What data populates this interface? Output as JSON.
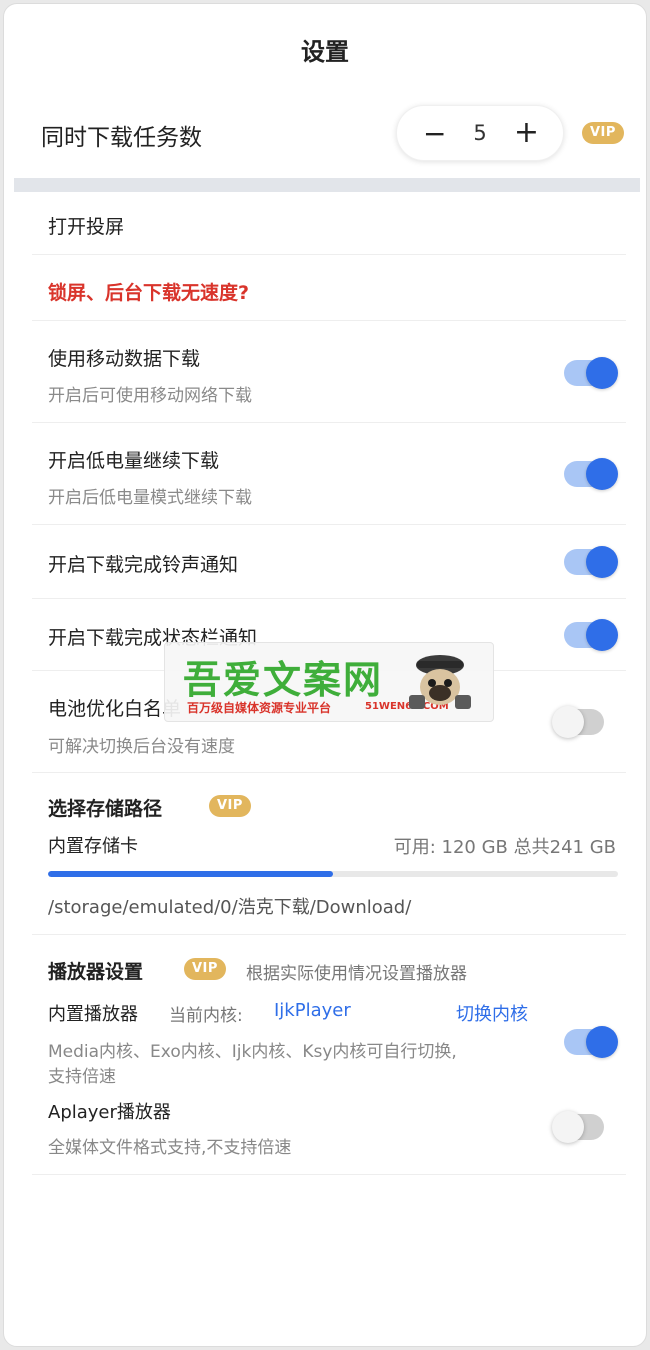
{
  "header": {
    "title": "设置"
  },
  "concurrent": {
    "label": "同时下载任务数",
    "minus": "−",
    "value": "5",
    "plus": "+",
    "vip": "VIP"
  },
  "items": {
    "cast": {
      "label": "打开投屏"
    },
    "lockscreen": {
      "label": "锁屏、后台下载无速度?"
    },
    "mobile_data": {
      "label": "使用移动数据下载",
      "sub": "开启后可使用移动网络下载",
      "enabled": true
    },
    "low_battery": {
      "label": "开启低电量继续下载",
      "sub": "开启后低电量模式继续下载",
      "enabled": true
    },
    "ringtone": {
      "label": "开启下载完成铃声通知",
      "enabled": true
    },
    "statusbar": {
      "label": "开启下载完成状态栏通知",
      "enabled": true
    },
    "battery_whitelist": {
      "label": "电池优化白名单",
      "sub": "可解决切换后台没有速度",
      "enabled": false
    }
  },
  "storage": {
    "label": "选择存储路径",
    "vip": "VIP",
    "card": "内置存储卡",
    "info": "可用: 120 GB 总共241 GB",
    "used_fraction": 0.5,
    "path": "/storage/emulated/0/浩克下载/Download/"
  },
  "player": {
    "label": "播放器设置",
    "vip": "VIP",
    "hint": "根据实际使用情况设置播放器",
    "builtin_label": "内置播放器",
    "core_prefix": "当前内核:",
    "core_name": "IjkPlayer",
    "switch_core": "切换内核",
    "builtin_desc_1": "Media内核、Exo内核、Ijk内核、Ksy内核可自行切换,",
    "builtin_desc_2": "支持倍速",
    "builtin_enabled": true,
    "aplayer_label": "Aplayer播放器",
    "aplayer_desc": "全媒体文件格式支持,不支持倍速",
    "aplayer_enabled": false
  },
  "watermark": {
    "main": "吾爱文案网",
    "sub": "百万级自媒体资源专业平台",
    "url": "51WEN66.COM"
  },
  "colors": {
    "accent": "#2f6ee8",
    "vip": "#e2b65d",
    "warning": "#d9342b"
  }
}
